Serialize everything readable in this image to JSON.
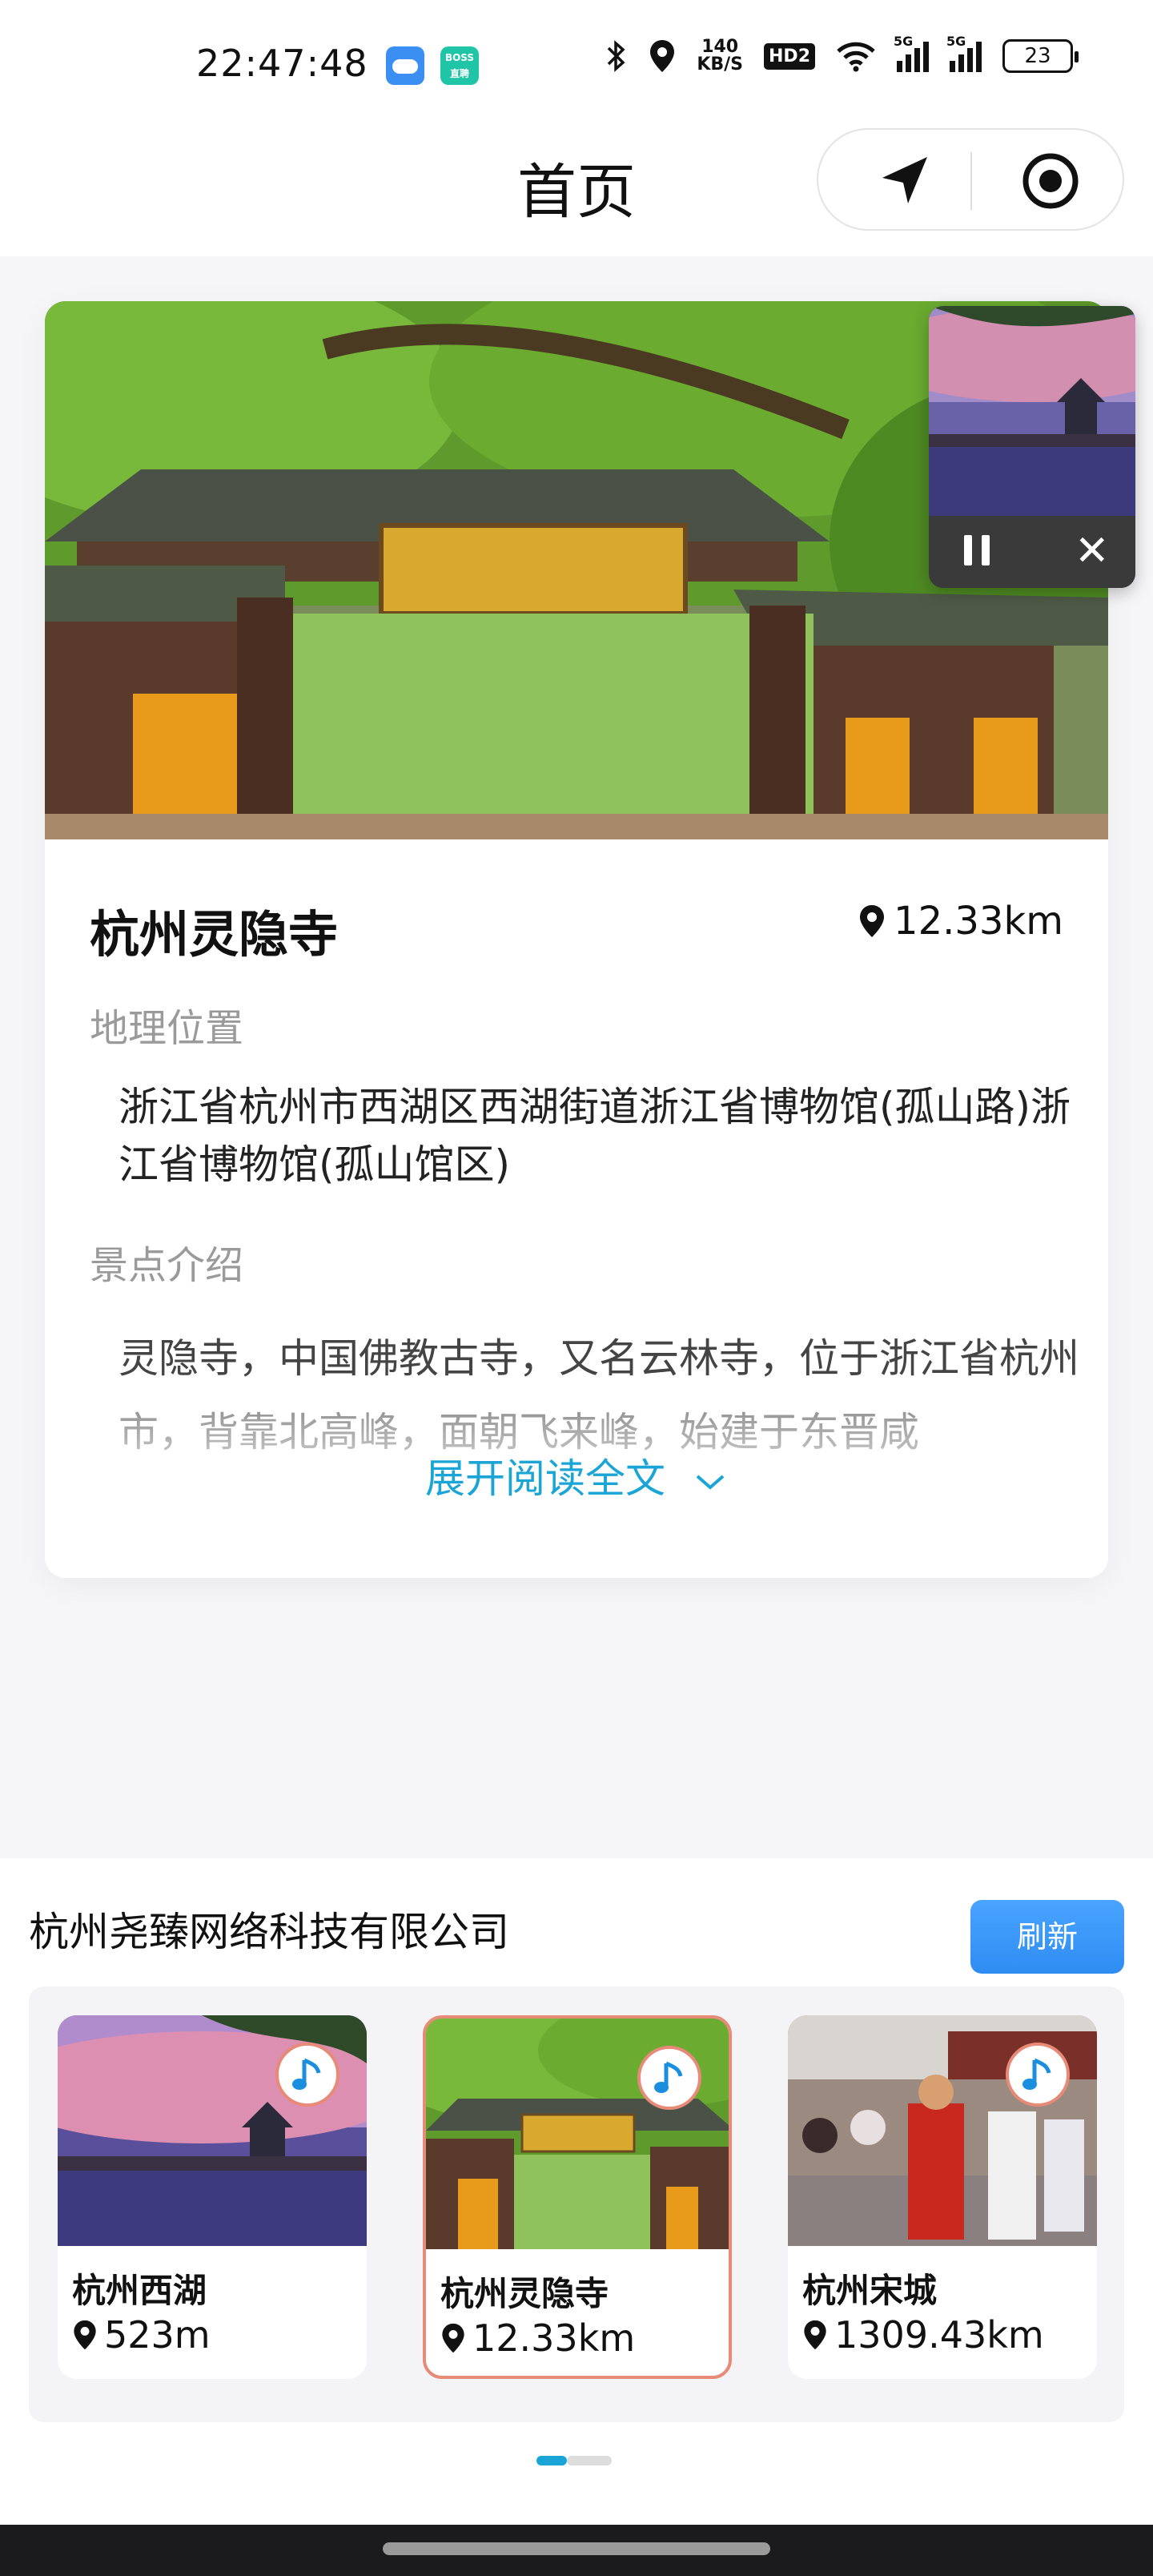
{
  "status_bar": {
    "time": "22:47:48",
    "boss_app_label": "BOSS\n直聘",
    "net_speed": "140\nKB/S",
    "hd_label": "HD2",
    "signal_1_tag": "5G",
    "signal_2_tag": "5G",
    "battery": "23"
  },
  "nav": {
    "title": "首页"
  },
  "card": {
    "title": "杭州灵隐寺",
    "distance": "12.33km",
    "address_label": "地理位置",
    "address": "浙江省杭州市西湖区西湖街道浙江省博物馆(孤山路)浙江省博物馆(孤山馆区)",
    "intro_label": "景点介绍",
    "intro": "灵隐寺，中国佛教古寺，又名云林寺，位于浙江省杭州市，背靠北高峰，面朝飞来峰，始建于东晋咸",
    "expand_label": "展开阅读全文"
  },
  "panel": {
    "company": "杭州尧臻网络科技有限公司",
    "refresh_label": "刷新",
    "spots": [
      {
        "name": "杭州西湖",
        "distance": "523m"
      },
      {
        "name": "杭州灵隐寺",
        "distance": "12.33km"
      },
      {
        "name": "杭州宋城",
        "distance": "1309.43km"
      }
    ]
  },
  "colors": {
    "accent": "#1aa5d6",
    "refresh_button": "#3d97f8",
    "active_border": "#e88a78"
  },
  "icons": {
    "location_pin": "map-pin-icon",
    "music": "music-note-icon",
    "navigate": "location-arrow-icon",
    "target": "record-target-icon"
  }
}
